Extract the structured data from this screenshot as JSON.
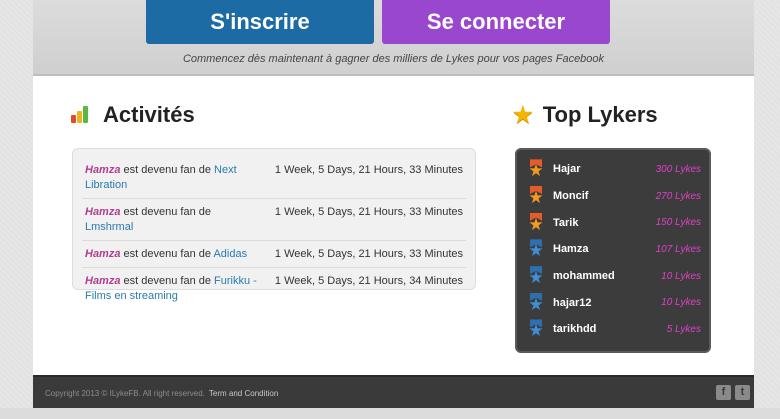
{
  "hero": {
    "signup_label": "S'inscrire",
    "login_label": "Se connecter",
    "tagline": "Commencez dès maintenant à gagner des milliers de Lykes pour vos pages Facebook"
  },
  "activities": {
    "title": "Activités",
    "icon": "bar-chart-icon",
    "rows": [
      {
        "user": "Hamza",
        "text": " est devenu fan de ",
        "page": "Next Libration",
        "time": "1 Week, 5 Days, 21 Hours, 33 Minutes"
      },
      {
        "user": "Hamza",
        "text": " est devenu fan de ",
        "page": "Lmshrmal",
        "time": "1 Week, 5 Days, 21 Hours, 33 Minutes"
      },
      {
        "user": "Hamza",
        "text": " est devenu fan de ",
        "page": "Adidas",
        "time": "1 Week, 5 Days, 21 Hours, 33 Minutes"
      },
      {
        "user": "Hamza",
        "text": " est devenu fan de ",
        "page": "Furikku - Films en streaming",
        "time": "1 Week, 5 Days, 21 Hours, 34 Minutes"
      }
    ]
  },
  "top_lykers": {
    "title": "Top Lykers",
    "icon": "star-icon",
    "rows": [
      {
        "name": "Hajar",
        "count": "300 Lykes",
        "medal": "gold"
      },
      {
        "name": "Moncif",
        "count": "270 Lykes",
        "medal": "gold"
      },
      {
        "name": "Tarik",
        "count": "150 Lykes",
        "medal": "gold"
      },
      {
        "name": "Hamza",
        "count": "107 Lykes",
        "medal": "blue"
      },
      {
        "name": "mohammed",
        "count": "10 Lykes",
        "medal": "blue"
      },
      {
        "name": "hajar12",
        "count": "10 Lykes",
        "medal": "blue"
      },
      {
        "name": "tarikhdd",
        "count": "5 Lykes",
        "medal": "blue"
      }
    ]
  },
  "footer": {
    "copyright": "Copyright 2013 © ILykeFB. All right reserved.",
    "term_label": "Term and Condition",
    "facebook_label": "f",
    "twitter_label": "t"
  },
  "colors": {
    "signup": "#1c6ba4",
    "login": "#9a47cf",
    "user_name": "#b0408e",
    "link": "#2a7ab0",
    "lykes_count": "#e040c8",
    "medal_gold": "#f39a1f",
    "medal_blue": "#3d8fd8"
  }
}
